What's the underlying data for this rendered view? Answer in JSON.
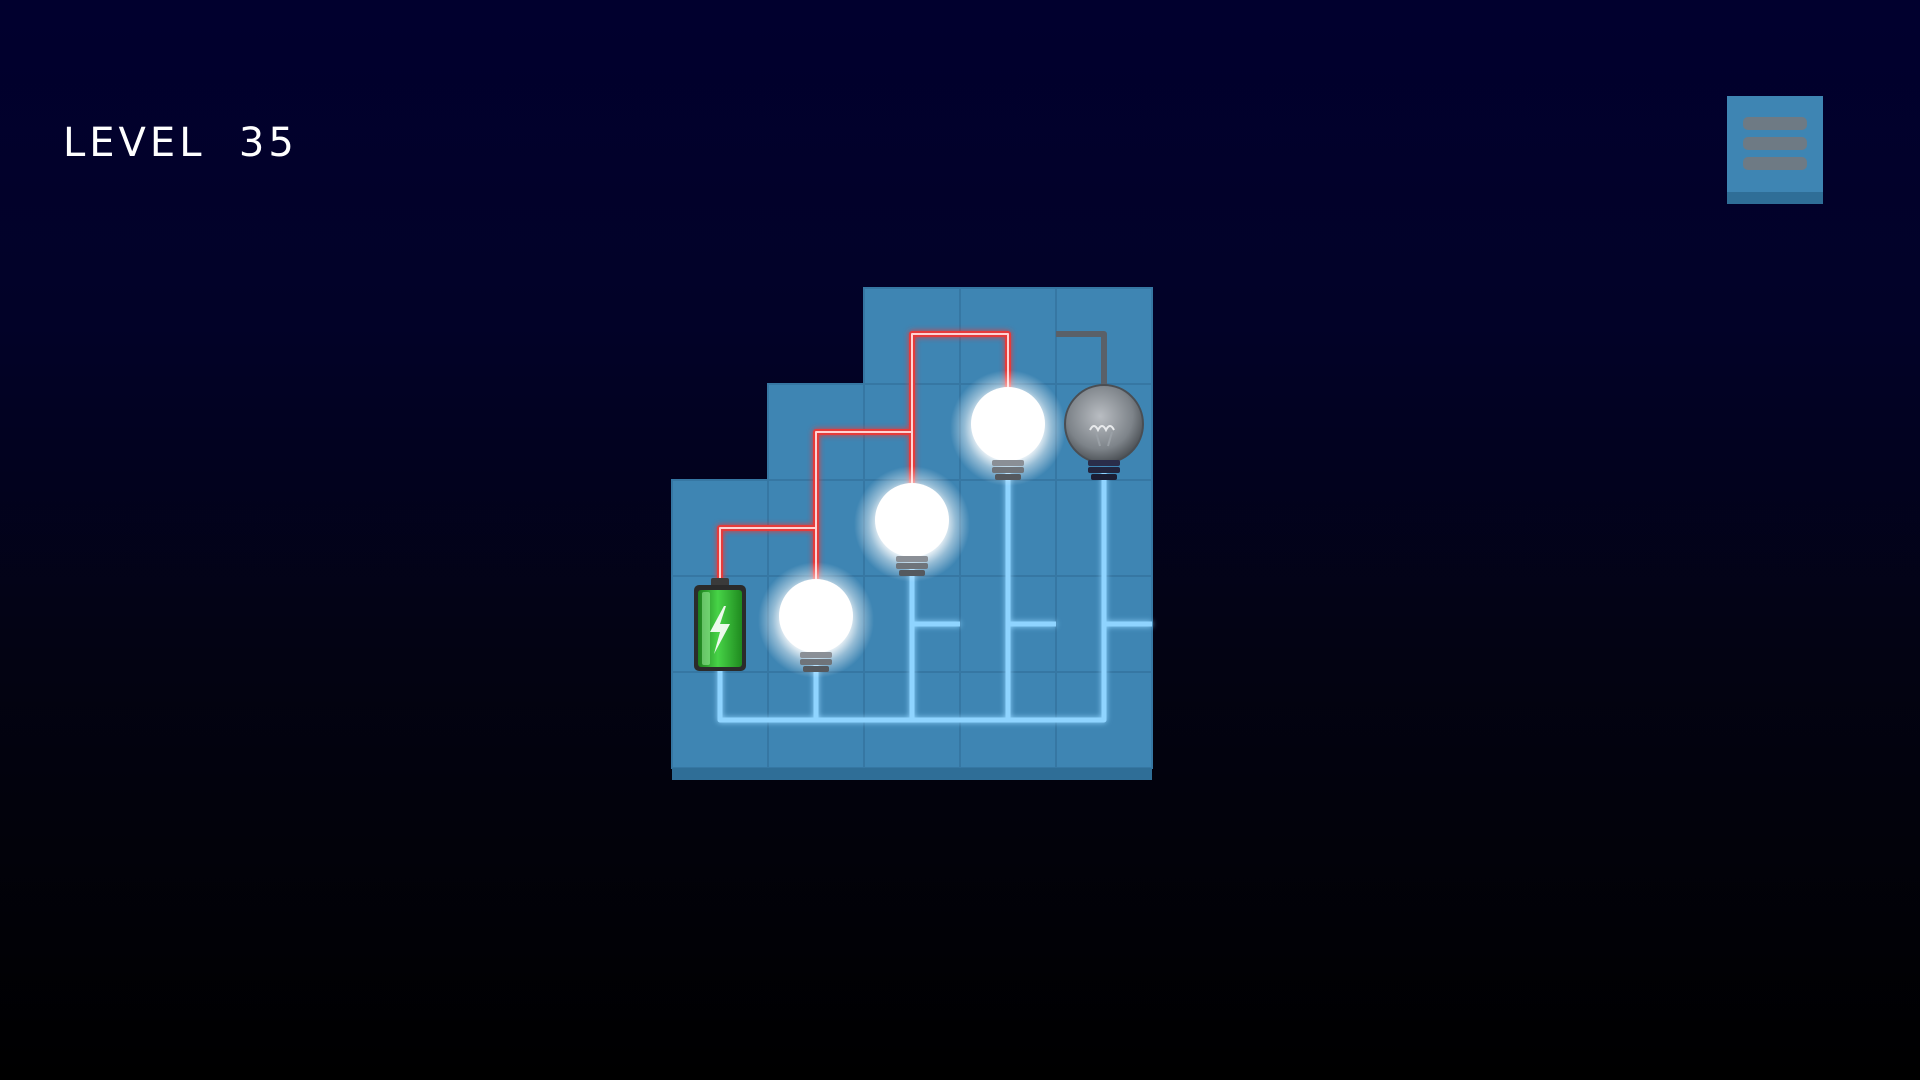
{
  "hud": {
    "level_label": "LEVEL",
    "level_number": "35",
    "menu_icon": "hamburger-menu-icon"
  },
  "colors": {
    "tile": "#3e85b3",
    "tile_edge": "#2f6e97",
    "grid_line": "#3677a3",
    "wire_lit": "#e53b3b",
    "wire_return": "#8fd4ff",
    "wire_dead": "#5a6068",
    "battery": "#2fb52f"
  },
  "board": {
    "columns": 5,
    "rows": 5,
    "filled_rows": [
      [
        2,
        4
      ],
      [
        1,
        4
      ],
      [
        0,
        4
      ],
      [
        0,
        4
      ],
      [
        0,
        4
      ]
    ],
    "battery": {
      "row": 3,
      "col": 0,
      "icon": "battery-icon"
    },
    "bulbs": [
      {
        "row": 3,
        "col": 1,
        "lit": true
      },
      {
        "row": 2,
        "col": 2,
        "lit": true
      },
      {
        "row": 1,
        "col": 3,
        "lit": true
      },
      {
        "row": 1,
        "col": 4,
        "lit": false
      }
    ]
  }
}
